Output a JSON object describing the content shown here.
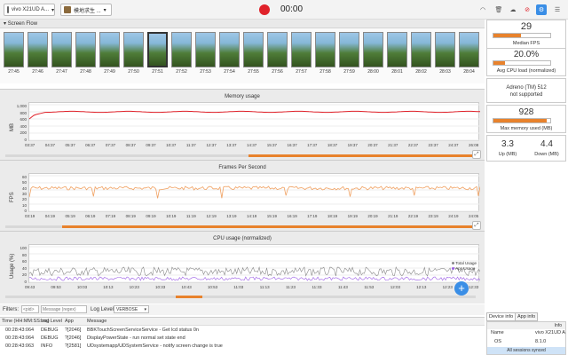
{
  "toolbar": {
    "device_label": "vivo X21UD A...",
    "app_label": "模地求生 ...",
    "timer": "00:00"
  },
  "screen_flow": {
    "title": "Screen Flow",
    "thumbnails": [
      "27:45",
      "27:46",
      "27:47",
      "27:48",
      "27:49",
      "27:50",
      "27:51",
      "27:52",
      "27:53",
      "27:54",
      "27:55",
      "27:56",
      "27:57",
      "27:58",
      "27:59",
      "28:00",
      "28:01",
      "28:02",
      "28:03",
      "28:04"
    ],
    "selected_index": 6
  },
  "memory_chart": {
    "title": "Memory usage",
    "ylabel": "MB",
    "yticks": [
      "1,000",
      "800",
      "600",
      "400",
      "200",
      "0"
    ],
    "xticks": [
      "03:37",
      "04:37",
      "05:37",
      "06:37",
      "07:37",
      "08:37",
      "09:37",
      "10:37",
      "11:37",
      "12:37",
      "13:37",
      "14:37",
      "15:37",
      "16:37",
      "17:37",
      "18:37",
      "19:37",
      "20:37",
      "21:37",
      "22:37",
      "23:37",
      "24:37",
      "26:08"
    ],
    "first_xtick": "02:37",
    "scroll_position": 0.55
  },
  "fps_chart": {
    "title": "Frames Per Second",
    "ylabel": "FPS",
    "yticks": [
      "60",
      "50",
      "40",
      "30",
      "20",
      "10",
      "0"
    ],
    "xticks": [
      "03:19",
      "04:19",
      "05:19",
      "06:19",
      "07:19",
      "08:19",
      "09:19",
      "10:19",
      "11:19",
      "12:19",
      "13:19",
      "14:19",
      "15:19",
      "16:19",
      "17:19",
      "18:19",
      "19:19",
      "20:19",
      "21:19",
      "22:19",
      "23:19",
      "24:19",
      "24:05"
    ],
    "first_xtick": "03:19",
    "scroll_position": 0.55
  },
  "cpu_chart": {
    "title": "CPU usage (normalized)",
    "ylabel": "Usage (%)",
    "yticks": [
      "100",
      "80",
      "60",
      "40",
      "20",
      "0"
    ],
    "xticks": [
      "09:43",
      "09:53",
      "10:03",
      "10:13",
      "10:23",
      "10:33",
      "10:43",
      "10:53",
      "11:03",
      "11:13",
      "11:23",
      "11:33",
      "11:43",
      "11:53",
      "12:03",
      "12:13",
      "12:23",
      "12:33"
    ],
    "legend": [
      "Total Usage",
      "App Usage"
    ],
    "legend_colors": [
      "#888888",
      "#9b5de5"
    ],
    "scroll_position": 0.37
  },
  "metrics": {
    "median_fps": {
      "value": "29",
      "label": "Median FPS",
      "fill": 0.48
    },
    "avg_cpu": {
      "value": "20.0%",
      "label": "Avg CPU load (normalized)",
      "fill": 0.2
    },
    "gpu": {
      "line1": "Adreno (TM) 512",
      "line2": "not supported"
    },
    "max_memory": {
      "value": "928",
      "label": "Max memory used (MB)",
      "fill": 0.93
    },
    "up": {
      "value": "3.3",
      "label": "Up (MB)"
    },
    "down": {
      "value": "4.4",
      "label": "Down (MB)"
    }
  },
  "filters": {
    "label": "Filters:",
    "pid_placeholder": "<pid>",
    "message_placeholder": "Message (regex)",
    "log_level_label": "Log Level:",
    "log_level_value": "VERBOSE"
  },
  "log_table": {
    "headers": [
      "Time (HH:MM:SS:ms)",
      "Log Level",
      "App",
      "Message"
    ],
    "rows": [
      [
        "00:28:43:064",
        "DEBUG",
        "?[2046]",
        "BBKTouchScreenServiceService - Get lcd status 0n"
      ],
      [
        "00:28:43:064",
        "DEBUG",
        "?[2046]",
        "DisplayPowerState - run normal set state end"
      ],
      [
        "00:28:43:063",
        "INFO",
        "?[2581]",
        "UDsystemapp/UDSystemService - notify screen change is true"
      ]
    ]
  },
  "info_panel": {
    "tabs": [
      "Device info",
      "App info"
    ],
    "header": "Info",
    "rows": [
      [
        "Name",
        "vivo X21UD A"
      ],
      [
        "OS",
        "8.1.0"
      ]
    ],
    "footer": "All sessions synced"
  },
  "colors": {
    "accent": "#e8822c",
    "memory_line": "#e0222a",
    "fps_line": "#f0a060",
    "record": "#e0222a"
  }
}
